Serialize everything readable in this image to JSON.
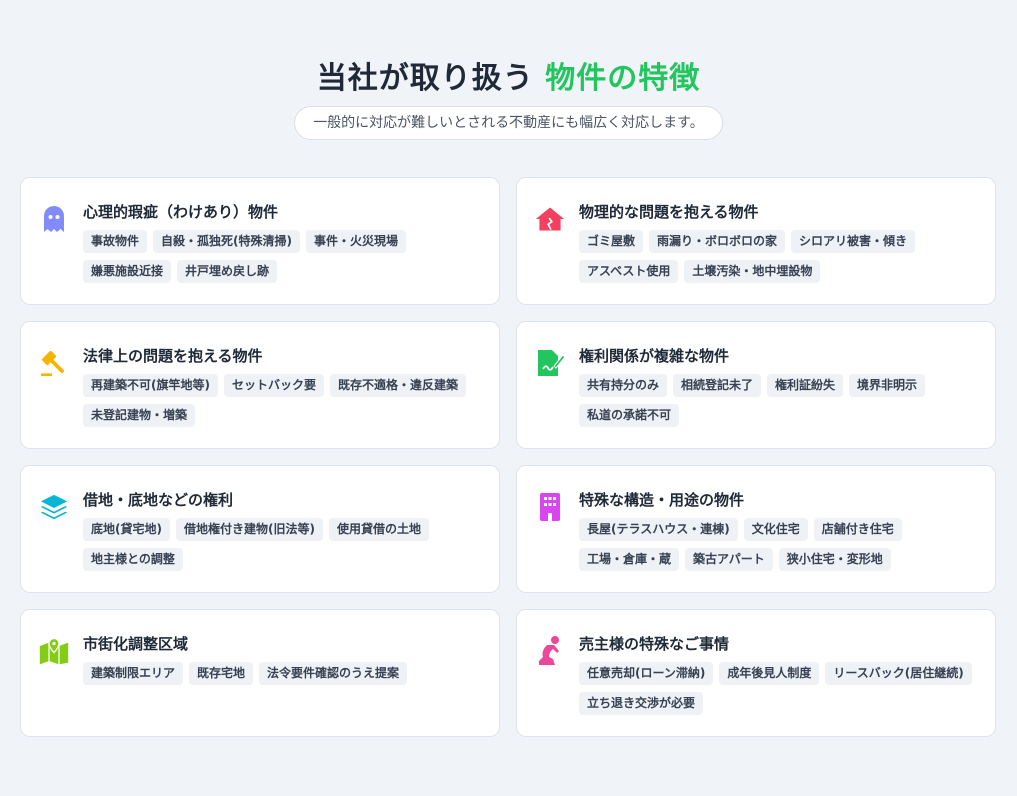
{
  "header": {
    "title_main": "当社が取り扱う",
    "title_accent": "物件の特徴",
    "subtitle": "一般的に対応が難しいとされる不動産にも幅広く対応します。"
  },
  "colors": {
    "accent": "#22c55e",
    "background": "#f0f3f8"
  },
  "cards": [
    {
      "title": "心理的瑕疵（わけあり）物件",
      "icon": "ghost-icon",
      "icon_color": "#818cf8",
      "tags": [
        "事故物件",
        "自殺・孤独死(特殊清掃)",
        "事件・火災現場",
        "嫌悪施設近接",
        "井戸埋め戻し跡"
      ]
    },
    {
      "title": "物理的な問題を抱える物件",
      "icon": "broken-house-icon",
      "icon_color": "#f43f5e",
      "tags": [
        "ゴミ屋敷",
        "雨漏り・ボロボロの家",
        "シロアリ被害・傾き",
        "アスベスト使用",
        "土壌汚染・地中埋設物"
      ]
    },
    {
      "title": "法律上の問題を抱える物件",
      "icon": "gavel-icon",
      "icon_color": "#f5b400",
      "tags": [
        "再建築不可(旗竿地等)",
        "セットバック要",
        "既存不適格・違反建築",
        "未登記建物・増築"
      ]
    },
    {
      "title": "権利関係が複雑な物件",
      "icon": "signature-document-icon",
      "icon_color": "#22c55e",
      "tags": [
        "共有持分のみ",
        "相続登記未了",
        "権利証紛失",
        "境界非明示",
        "私道の承諾不可"
      ]
    },
    {
      "title": "借地・底地などの権利",
      "icon": "layers-icon",
      "icon_color": "#06b6d4",
      "tags": [
        "底地(貸宅地)",
        "借地権付き建物(旧法等)",
        "使用貸借の土地",
        "地主様との調整"
      ]
    },
    {
      "title": "特殊な構造・用途の物件",
      "icon": "building-icon",
      "icon_color": "#d946ef",
      "tags": [
        "長屋(テラスハウス・連棟)",
        "文化住宅",
        "店舗付き住宅",
        "工場・倉庫・蔵",
        "築古アパート",
        "狭小住宅・変形地"
      ]
    },
    {
      "title": "市街化調整区域",
      "icon": "map-location-icon",
      "icon_color": "#84cc16",
      "tags": [
        "建築制限エリア",
        "既存宅地",
        "法令要件確認のうえ提案"
      ]
    },
    {
      "title": "売主様の特殊なご事情",
      "icon": "praying-person-icon",
      "icon_color": "#ec4899",
      "tags": [
        "任意売却(ローン滞納)",
        "成年後見人制度",
        "リースバック(居住継続)",
        "立ち退き交渉が必要"
      ]
    }
  ]
}
